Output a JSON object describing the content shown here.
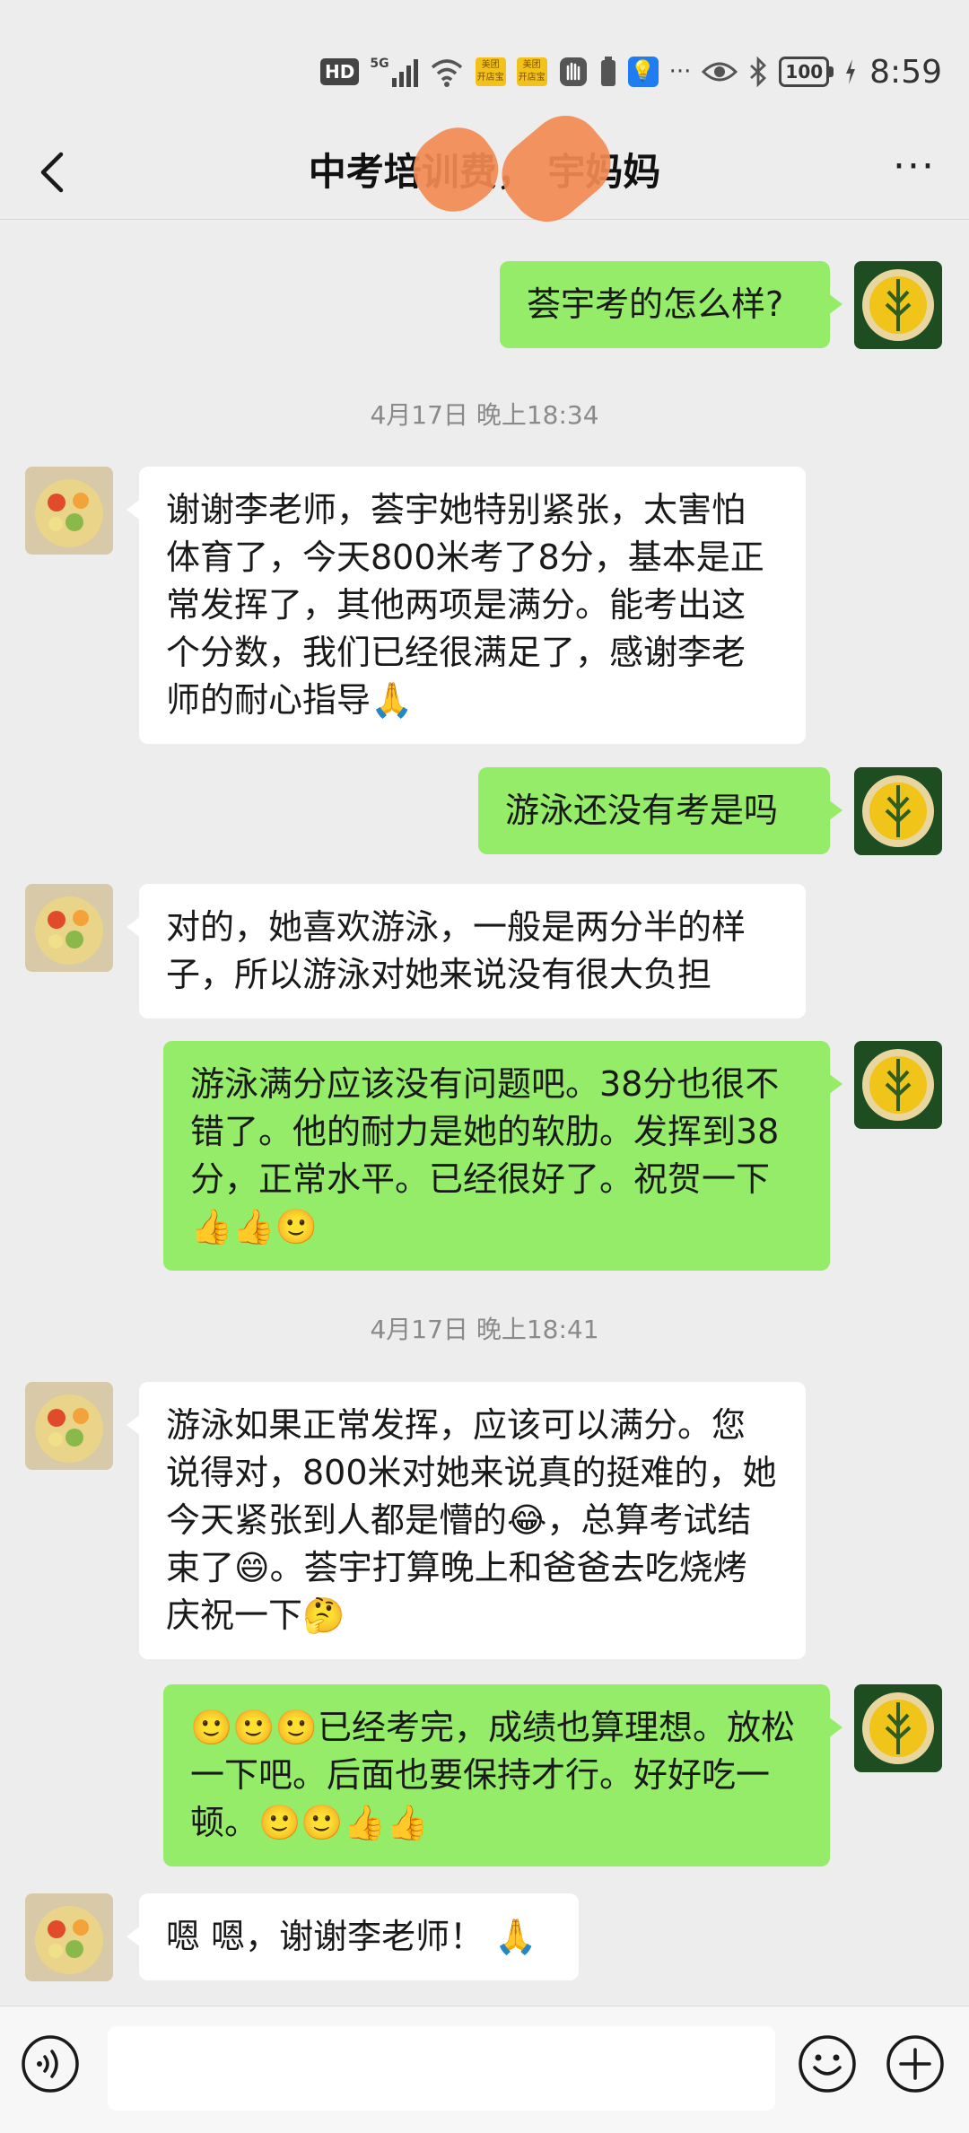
{
  "status_bar": {
    "hd": "HD",
    "network": "5G",
    "app_badge_1": "美团\n开店宝",
    "app_badge_2": "美团\n开店宝",
    "battery": "100",
    "time": "8:59"
  },
  "header": {
    "title": "中考培训费，    宇妈妈",
    "more_label": "···"
  },
  "messages": [
    {
      "sender": "me",
      "text": "荟宇考的怎么样?"
    },
    {
      "type": "timestamp",
      "text": "4月17日 晚上18:34"
    },
    {
      "sender": "them",
      "text": "谢谢李老师，荟宇她特别紧张，太害怕体育了，今天800米考了8分，基本是正常发挥了，其他两项是满分。能考出这个分数，我们已经很满足了，感谢李老师的耐心指导🙏"
    },
    {
      "sender": "me",
      "text": "游泳还没有考是吗"
    },
    {
      "sender": "them",
      "text": "对的，她喜欢游泳，一般是两分半的样子，所以游泳对她来说没有很大负担"
    },
    {
      "sender": "me",
      "text": "游泳满分应该没有问题吧。38分也很不错了。他的耐力是她的软肋。发挥到38分，正常水平。已经很好了。祝贺一下👍👍🙂"
    },
    {
      "type": "timestamp",
      "text": "4月17日 晚上18:41"
    },
    {
      "sender": "them",
      "text": "游泳如果正常发挥，应该可以满分。您说得对，800米对她来说真的挺难的，她今天紧张到人都是懵的😂，总算考试结束了😄。荟宇打算晚上和爸爸去吃烧烤庆祝一下🤔"
    },
    {
      "sender": "me",
      "text": "🙂🙂🙂已经考完，成绩也算理想。放松一下吧。后面也要保持才行。好好吃一顿。🙂🙂👍👍"
    },
    {
      "sender": "them",
      "text": "嗯 嗯，谢谢李老师！ 🙏"
    }
  ],
  "input": {
    "placeholder": ""
  },
  "colors": {
    "me_bubble": "#95ec69",
    "them_bubble": "#ffffff",
    "background": "#ededed"
  }
}
